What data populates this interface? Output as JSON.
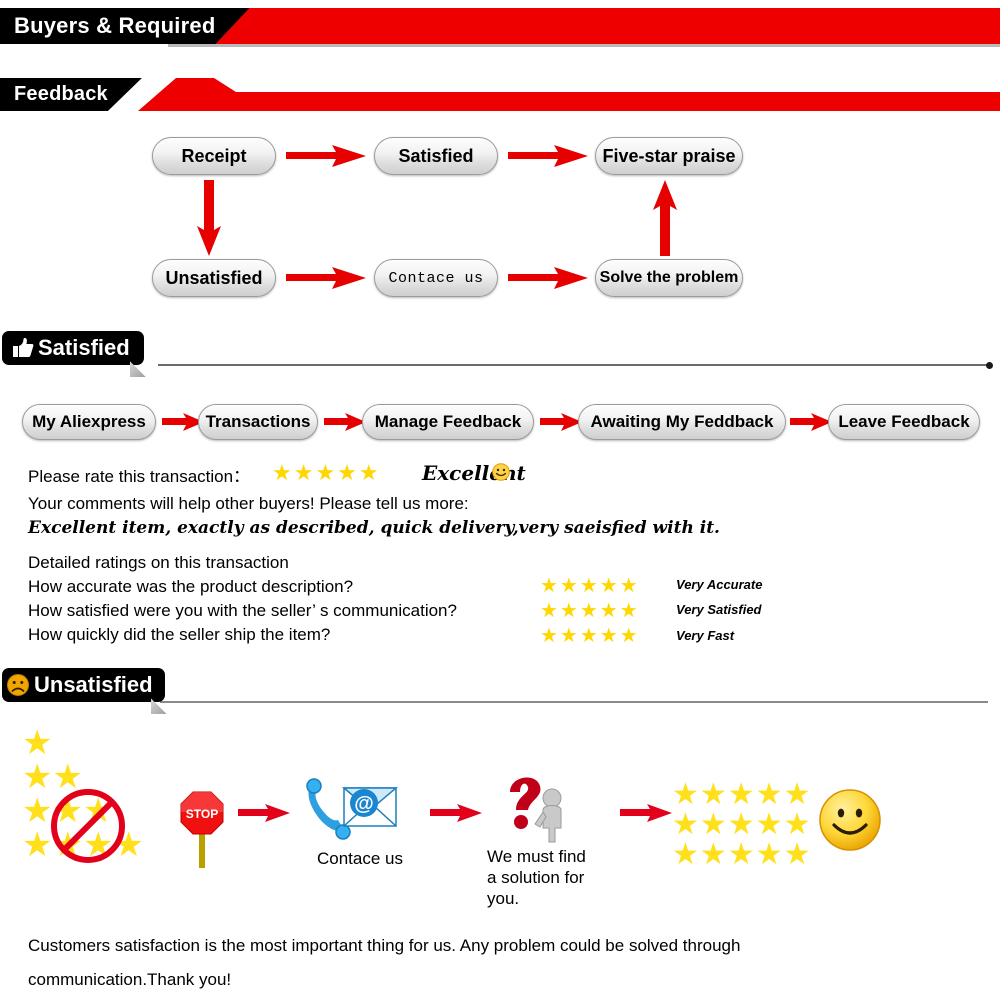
{
  "banners": {
    "buyers": {
      "label": "Buyers & Required"
    },
    "feedback": {
      "label": "Feedback"
    },
    "satisfied": {
      "label": "Satisfied",
      "icon": "thumbs-up-icon"
    },
    "unsatisfied": {
      "label": "Unsatisfied",
      "icon": "sad-face-icon"
    }
  },
  "colors": {
    "red": "#ee0000",
    "arrow_red": "#e60000",
    "black": "#000000",
    "star_yellow": "#FFD700",
    "pill_border": "#9a9a9a"
  },
  "flowchart": {
    "nodes": {
      "receipt": "Receipt",
      "satisfied": "Satisfied",
      "five_star": "Five-star praise",
      "unsatisfied": "Unsatisfied",
      "contact": "Contace us",
      "solve": "Solve the problem"
    }
  },
  "breadcrumb": {
    "steps": [
      "My Aliexpress",
      "Transactions",
      "Manage Feedback",
      "Awaiting My Feddback",
      "Leave Feedback"
    ]
  },
  "rating": {
    "prompt": "Please rate this transaction：",
    "stars": "★★★★★",
    "word": "Excellent",
    "smiley": "smiley-face-icon",
    "comments_prompt": "Your comments will help other buyers! Please tell us more:",
    "comment_text": "Excellent item, exactly as described, quick delivery,very saeisfied with it."
  },
  "detailed_ratings": {
    "heading": "Detailed ratings on this transaction",
    "rows": [
      {
        "question": "How accurate was the product description?",
        "stars": "★★★★★",
        "label": "Very Accurate"
      },
      {
        "question": "How satisfied were you with the seller’ s communication?",
        "stars": "★★★★★",
        "label": "Very Satisfied"
      },
      {
        "question": "How quickly did the seller ship the item?",
        "stars": "★★★★★",
        "label": "Very Fast"
      }
    ]
  },
  "unsatisfied_flow": {
    "bad_stars_icon": "no-low-rating-icon",
    "stop_sign": {
      "label": "STOP",
      "icon": "stop-sign-icon"
    },
    "contact": {
      "caption": "Contace us",
      "icon": "phone-email-icon"
    },
    "solution": {
      "caption": "We must find\na solution for\nyou.",
      "icon": "question-mark-person-icon"
    },
    "good_stars_icon": "five-star-grid-icon",
    "smiley_icon": "big-smiley-face-icon"
  },
  "footer": {
    "line1": "Customers satisfaction is the most important thing for us. Any problem could be solved through",
    "line2": "communication.Thank you!"
  }
}
